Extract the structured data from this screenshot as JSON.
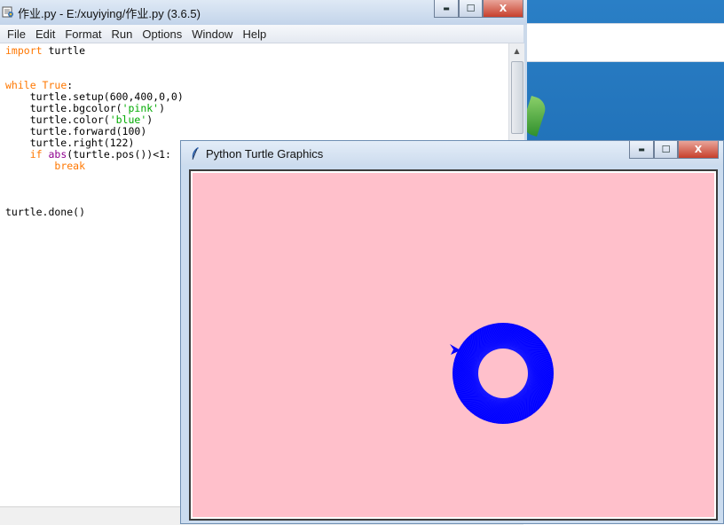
{
  "idle": {
    "title": "作业.py - E:/xuyiying/作业.py (3.6.5)",
    "menu": [
      "File",
      "Edit",
      "Format",
      "Run",
      "Options",
      "Window",
      "Help"
    ],
    "code": {
      "line1_kw": "import",
      "line1_rest": " turtle",
      "line2_kw": "while",
      "line2_true": " True",
      "line2_colon": ":",
      "setup": "    turtle.setup(600,400,0,0)",
      "bgcolor_pre": "    turtle.bgcolor(",
      "bgcolor_arg": "'pink'",
      "bgcolor_post": ")",
      "color_pre": "    turtle.color(",
      "color_arg": "'blue'",
      "color_post": ")",
      "forward": "    turtle.forward(100)",
      "right": "    turtle.right(122)",
      "if_indent": "    ",
      "if_kw": "if",
      "if_sp": " ",
      "if_abs": "abs",
      "if_rest": "(turtle.pos())<1:",
      "break_indent": "        ",
      "break_kw": "break",
      "done": "turtle.done()"
    }
  },
  "turtle_window": {
    "title": "Python Turtle Graphics",
    "background_color": "#ffc0cb",
    "pen_color": "#0000ff"
  },
  "caption_buttons": {
    "minimize": "▬",
    "maximize": "☐",
    "close": "X"
  },
  "icons": {
    "idle_app": "python-idle-icon",
    "turtle_app": "feather-icon"
  }
}
